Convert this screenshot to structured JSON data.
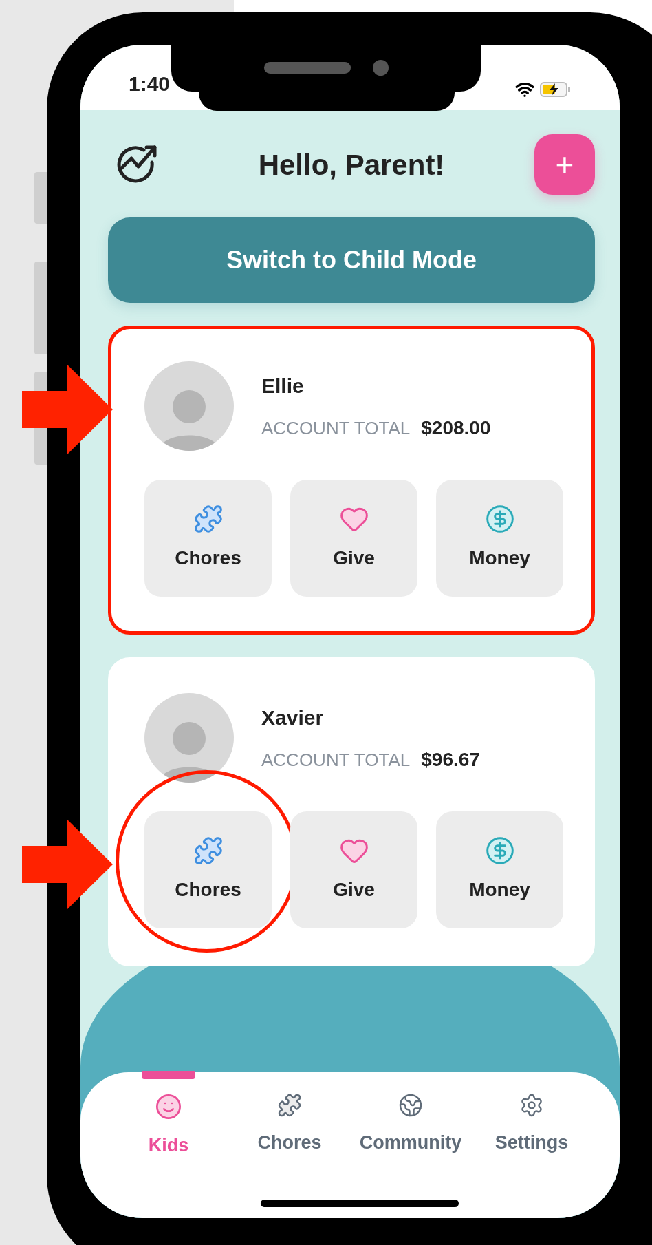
{
  "status_bar": {
    "time": "1:40"
  },
  "header": {
    "title": "Hello, Parent!",
    "add_button": "+"
  },
  "switch_button": "Switch to Child Mode",
  "kids": [
    {
      "name": "Ellie",
      "total_label": "ACCOUNT TOTAL",
      "total": "$208.00",
      "highlighted": true,
      "actions": [
        {
          "kind": "chores",
          "label": "Chores",
          "highlighted": false
        },
        {
          "kind": "give",
          "label": "Give",
          "highlighted": false
        },
        {
          "kind": "money",
          "label": "Money",
          "highlighted": false
        }
      ]
    },
    {
      "name": "Xavier",
      "total_label": "ACCOUNT TOTAL",
      "total": "$96.67",
      "highlighted": false,
      "actions": [
        {
          "kind": "chores",
          "label": "Chores",
          "highlighted": true
        },
        {
          "kind": "give",
          "label": "Give",
          "highlighted": false
        },
        {
          "kind": "money",
          "label": "Money",
          "highlighted": false
        }
      ]
    }
  ],
  "nav": [
    {
      "kind": "kids",
      "label": "Kids",
      "selected": true
    },
    {
      "kind": "chores",
      "label": "Chores",
      "selected": false
    },
    {
      "kind": "community",
      "label": "Community",
      "selected": false
    },
    {
      "kind": "settings",
      "label": "Settings",
      "selected": false
    }
  ]
}
